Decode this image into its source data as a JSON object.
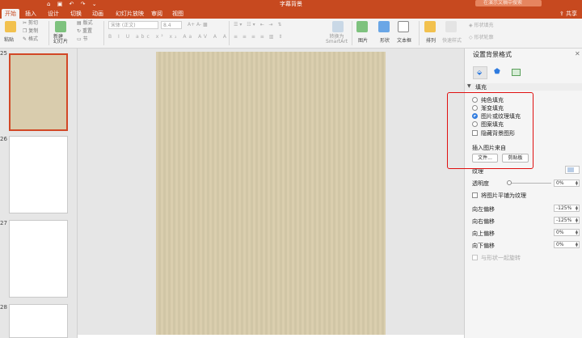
{
  "window": {
    "title": "字幕背景",
    "search_placeholder": "在演示文稿中搜索"
  },
  "tabs": [
    {
      "label": "开始",
      "active": true
    },
    {
      "label": "插入",
      "active": false
    },
    {
      "label": "设计",
      "active": false
    },
    {
      "label": "切换",
      "active": false
    },
    {
      "label": "动画",
      "active": false
    },
    {
      "label": "幻灯片放映",
      "active": false
    },
    {
      "label": "审阅",
      "active": false
    },
    {
      "label": "视图",
      "active": false
    }
  ],
  "share_label": "共享",
  "ribbon": {
    "paste": "粘贴",
    "cut": "剪切",
    "copy": "复制",
    "format": "格式",
    "new_slide": "新建\n幻灯片",
    "layout": "版式",
    "reset": "重置",
    "section": "节",
    "font_name": "宋体 (正文)",
    "font_size": "8.4",
    "convert_smartart": "转换为\nSmartArt",
    "picture": "图片",
    "shape": "形状",
    "textbox": "文本框",
    "arrange": "排列",
    "quick_styles": "快速样式",
    "shape_fill": "形状填充",
    "shape_outline": "形状轮廓"
  },
  "slides": [
    {
      "number": "25"
    },
    {
      "number": "26"
    },
    {
      "number": "27"
    },
    {
      "number": "28"
    }
  ],
  "pane": {
    "title": "设置背景格式",
    "section_fill": "填充",
    "options": [
      {
        "label": "纯色填充",
        "selected": false
      },
      {
        "label": "渐变填充",
        "selected": false
      },
      {
        "label": "图片或纹理填充",
        "selected": true
      },
      {
        "label": "图案填充",
        "selected": false
      }
    ],
    "hide_bg": "隐藏背景图形",
    "insert_from": "插入图片来自",
    "file_button": "文件...",
    "clipboard_button": "剪贴板",
    "texture": "纹理",
    "transparency": "透明度",
    "transparency_value": "0%",
    "tile": "将图片平铺为纹理",
    "offset_left": "向左偏移",
    "offset_left_value": "-125%",
    "offset_right": "向右偏移",
    "offset_right_value": "-125%",
    "offset_top": "向上偏移",
    "offset_top_value": "0%",
    "offset_bottom": "向下偏移",
    "offset_bottom_value": "0%",
    "rotate_with_shape": "与形状一起旋转"
  },
  "colors": {
    "accent": "#c7491f",
    "slide_bg": "#d8ccab",
    "highlight": "#e01010"
  }
}
